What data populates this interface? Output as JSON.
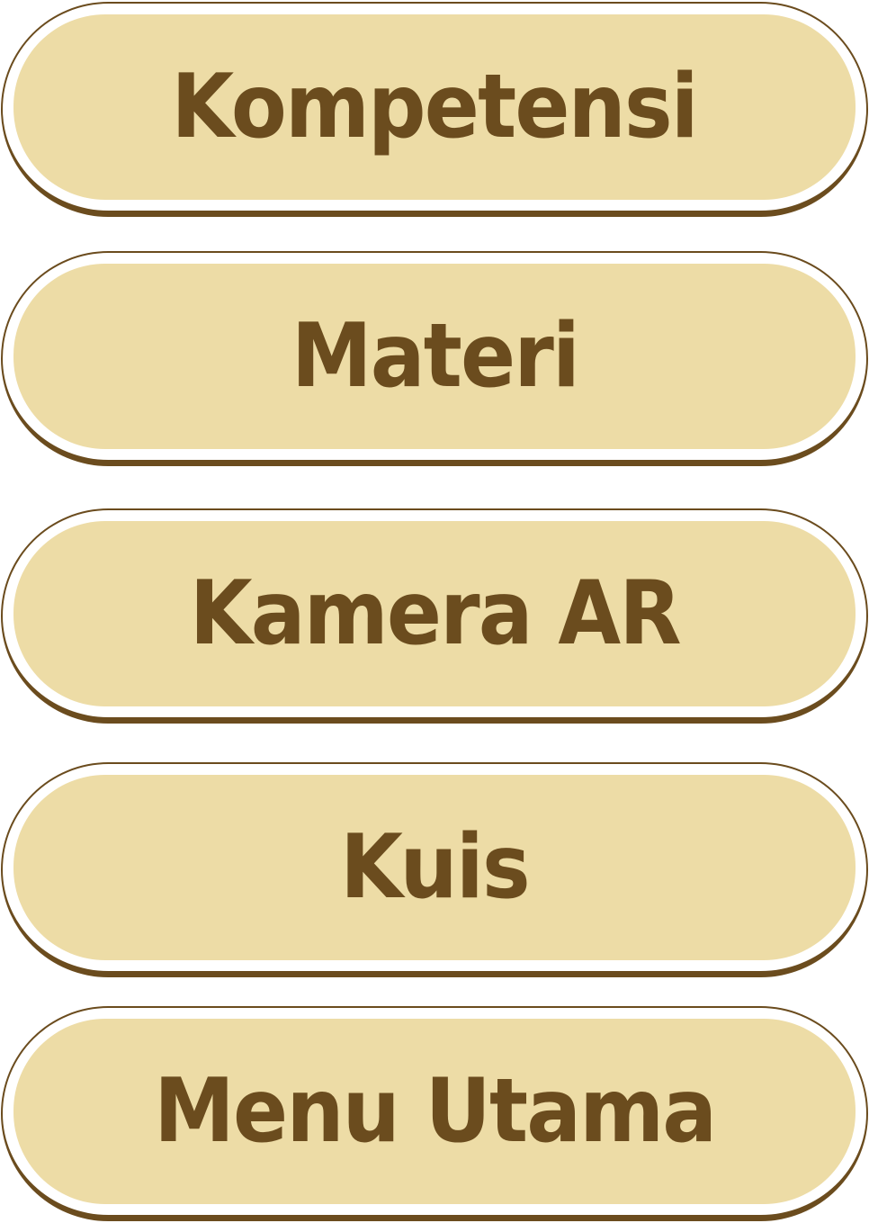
{
  "menu": {
    "items": [
      {
        "label": "Kompetensi"
      },
      {
        "label": "Materi"
      },
      {
        "label": "Kamera AR"
      },
      {
        "label": "Kuis"
      },
      {
        "label": "Menu Utama"
      }
    ]
  },
  "colors": {
    "brown": "#6b4c1e",
    "beige": "#eddca6",
    "background": "#ffffff"
  }
}
